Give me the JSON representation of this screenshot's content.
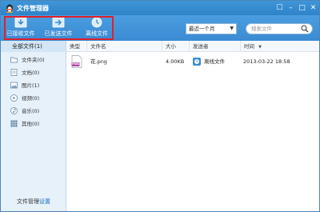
{
  "window": {
    "title": "文件管理器"
  },
  "toolbar": {
    "received_label": "已接收文件",
    "sent_label": "已发送文件",
    "offline_label": "离线文件"
  },
  "filter": {
    "selected": "最近一个月"
  },
  "search": {
    "placeholder": "搜索文件"
  },
  "sidebar": {
    "header": "全部文件(1)",
    "items": [
      {
        "label": "文件夹(0)",
        "icon": "folder-icon"
      },
      {
        "label": "文档(0)",
        "icon": "document-icon"
      },
      {
        "label": "图片(1)",
        "icon": "image-icon"
      },
      {
        "label": "视频(0)",
        "icon": "video-icon"
      },
      {
        "label": "音乐(0)",
        "icon": "music-icon"
      },
      {
        "label": "其他(0)",
        "icon": "other-icon"
      }
    ],
    "footer_prefix": "文件管理",
    "footer_link": "设置"
  },
  "table": {
    "headers": {
      "type": "类型",
      "name": "文件名",
      "size": "大小",
      "sender": "发送者",
      "time": "时间"
    },
    "rows": [
      {
        "type_badge": "PNG",
        "name": "花.png",
        "size": "4.00KB",
        "sender": "离线文件",
        "time": "2013-03-22 18:58"
      }
    ]
  },
  "colors": {
    "accent": "#3a8bd2",
    "highlight": "#e0202a",
    "link": "#1a6fc4"
  }
}
